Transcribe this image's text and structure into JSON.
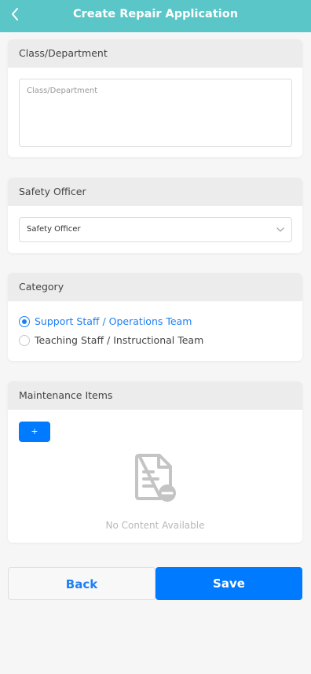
{
  "header": {
    "title": "Create Repair Application",
    "back_icon": "chevron-left-icon"
  },
  "class_department": {
    "label": "Class/Department",
    "placeholder": "Class/Department",
    "value": ""
  },
  "safety_officer": {
    "label": "Safety Officer",
    "selected": "Safety Officer"
  },
  "category": {
    "label": "Category",
    "options": [
      {
        "label": "Support Staff / Operations Team",
        "selected": true
      },
      {
        "label": "Teaching Staff / Instructional Team",
        "selected": false
      }
    ]
  },
  "maintenance_items": {
    "label": "Maintenance Items",
    "add_label": "+",
    "empty_text": "No Content Available",
    "empty_icon": "empty-document-icon"
  },
  "footer": {
    "back_label": "Back",
    "save_label": "Save"
  },
  "colors": {
    "header": "#5bc6c8",
    "primary": "#007aff",
    "accent": "#1e7ff5"
  }
}
